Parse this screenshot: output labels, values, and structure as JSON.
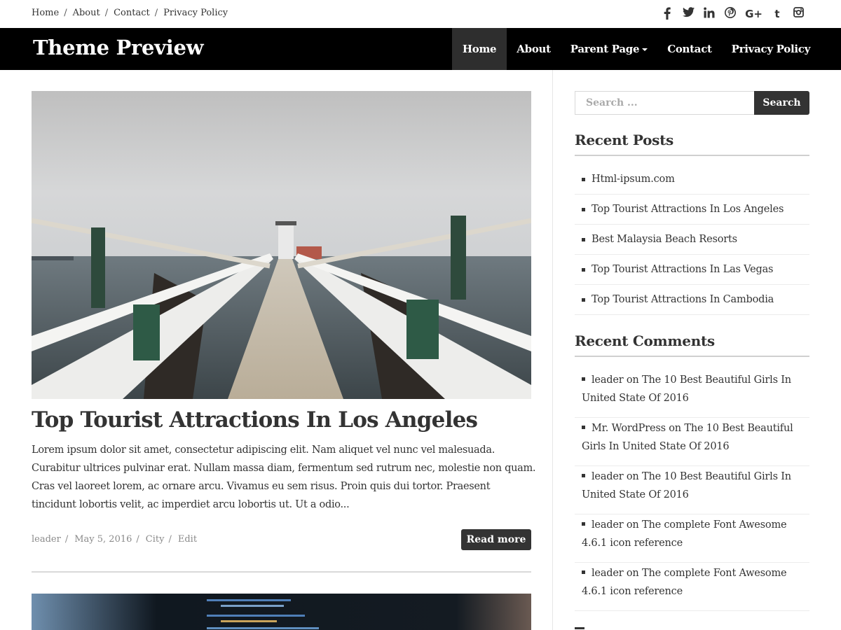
{
  "topbar": {
    "links": [
      "Home",
      "About",
      "Contact",
      "Privacy Policy"
    ],
    "separator": "/",
    "social_icons": [
      "facebook-icon",
      "twitter-icon",
      "linkedin-icon",
      "pinterest-icon",
      "google-plus-icon",
      "tumblr-icon",
      "instagram-icon"
    ]
  },
  "header": {
    "site_title": "Theme Preview",
    "nav": [
      "Home",
      "About",
      "Parent Page",
      "Contact",
      "Privacy Policy"
    ],
    "active_nav": "Home"
  },
  "post": {
    "title": "Top Tourist Attractions In Los Angeles",
    "excerpt": "Lorem ipsum dolor sit amet, consectetur adipiscing elit. Nam aliquet vel nunc vel malesuada. Curabitur ultrices pulvinar erat. Nullam massa diam, fermentum sed rutrum nec, molestie non quam. Cras vel laoreet lorem, ac ornare arcu. Vivamus eu sem risus. Proin quis dui tortor. Praesent tincidunt lobortis velit, ac imperdiet arcu lobortis ut. Ut a odio...",
    "author": "leader",
    "date": "May 5, 2016",
    "category": "City",
    "edit_label": "Edit",
    "read_more": "Read more"
  },
  "sidebar": {
    "search_placeholder": "Search ...",
    "search_button": "Search",
    "recent_posts_title": "Recent Posts",
    "recent_posts": [
      "Html-ipsum.com",
      "Top Tourist Attractions In Los Angeles",
      "Best Malaysia Beach Resorts",
      "Top Tourist Attractions In Las Vegas",
      "Top Tourist Attractions In Cambodia"
    ],
    "recent_comments_title": "Recent Comments",
    "recent_comments": [
      {
        "author": "leader",
        "on": "on",
        "post": "The 10 Best Beautiful Girls In United State Of 2016"
      },
      {
        "author": "Mr. WordPress",
        "on": "on",
        "post": "The 10 Best Beautiful Girls In United State Of 2016"
      },
      {
        "author": "leader",
        "on": "on",
        "post": "The 10 Best Beautiful Girls In United State Of 2016"
      },
      {
        "author": "leader",
        "on": "on",
        "post": "The complete Font Awesome 4.6.1 icon reference"
      },
      {
        "author": "leader",
        "on": "on",
        "post": "The complete Font Awesome 4.6.1 icon reference"
      }
    ]
  },
  "colors": {
    "header_bg": "#000000",
    "nav_active_bg": "#2e2e2e",
    "button_bg": "#333333",
    "text": "#333333",
    "meta_text": "#8a8a8a"
  }
}
